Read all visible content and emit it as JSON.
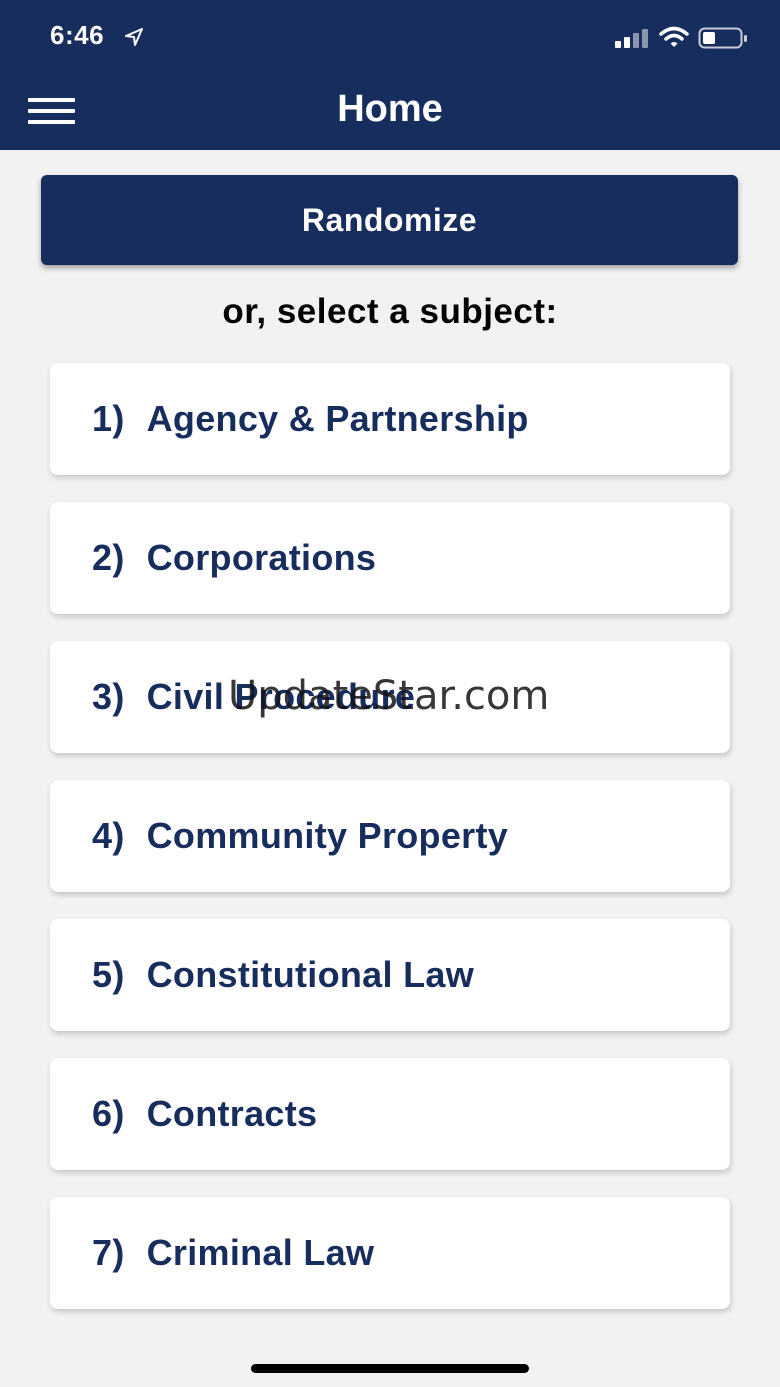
{
  "status_bar": {
    "time": "6:46",
    "icons": [
      "location-arrow-icon",
      "cellular-signal-icon",
      "wifi-icon",
      "battery-icon"
    ]
  },
  "header": {
    "title": "Home",
    "menu_icon": "hamburger-menu-icon",
    "background_color": "#172d5e"
  },
  "randomize_label": "Randomize",
  "subject_prompt": "or, select a subject:",
  "subjects": [
    {
      "number": "1)",
      "label": "Agency & Partnership"
    },
    {
      "number": "2)",
      "label": "Corporations"
    },
    {
      "number": "3)",
      "label": "Civil Procedure"
    },
    {
      "number": "4)",
      "label": "Community Property"
    },
    {
      "number": "5)",
      "label": "Constitutional Law"
    },
    {
      "number": "6)",
      "label": "Contracts"
    },
    {
      "number": "7)",
      "label": "Criminal Law"
    }
  ],
  "watermark": "UpdateStar.com",
  "colors": {
    "brand_navy": "#172d5e",
    "card_background": "#ffffff",
    "page_background": "#f2f2f2"
  }
}
